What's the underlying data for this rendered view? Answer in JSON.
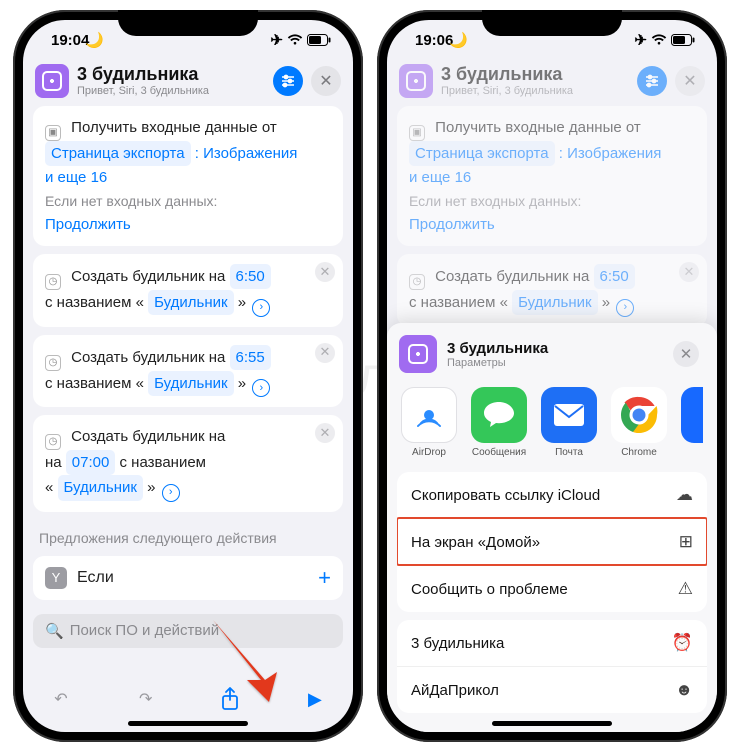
{
  "watermark": "Яблык",
  "phone1": {
    "status": {
      "time": "19:04"
    },
    "header": {
      "title": "3 будильника",
      "sub": "Привет, Siri, 3 будильника"
    },
    "input_card": {
      "label": "Получить входные данные от",
      "token1": "Страница экспорта",
      "token2": "Изображения",
      "more": "и еще 16",
      "noinput": "Если нет входных данных:",
      "cont": "Продолжить"
    },
    "alarms": [
      {
        "pre": "Создать будильник на",
        "time": "6:50",
        "withlabel": "с названием «",
        "name": "Будильник",
        "close": "»"
      },
      {
        "pre": "Создать будильник на",
        "time": "6:55",
        "withlabel": "с названием «",
        "name": "Будильник",
        "close": "»"
      },
      {
        "pre": "Создать будильник на",
        "time": "07:00",
        "withlabel": "с названием",
        "name": "Будильник",
        "close": "»",
        "line2pre": "«"
      }
    ],
    "next_label": "Предложения следующего действия",
    "suggestion": "Если",
    "search": "Поиск ПО и действий"
  },
  "phone2": {
    "status": {
      "time": "19:06"
    },
    "header": {
      "title": "3 будильника",
      "sub": "Привет, Siri, 3 будильника"
    },
    "sheet": {
      "title": "3 будильника",
      "sub": "Параметры",
      "apps": {
        "airdrop": "AirDrop",
        "messages": "Сообщения",
        "mail": "Почта",
        "chrome": "Chrome"
      },
      "rows": {
        "copy": "Скопировать ссылку iCloud",
        "home": "На экран «Домой»",
        "report": "Сообщить о проблеме",
        "alarms": "3 будильника",
        "fun": "АйДаПрикол"
      }
    }
  }
}
